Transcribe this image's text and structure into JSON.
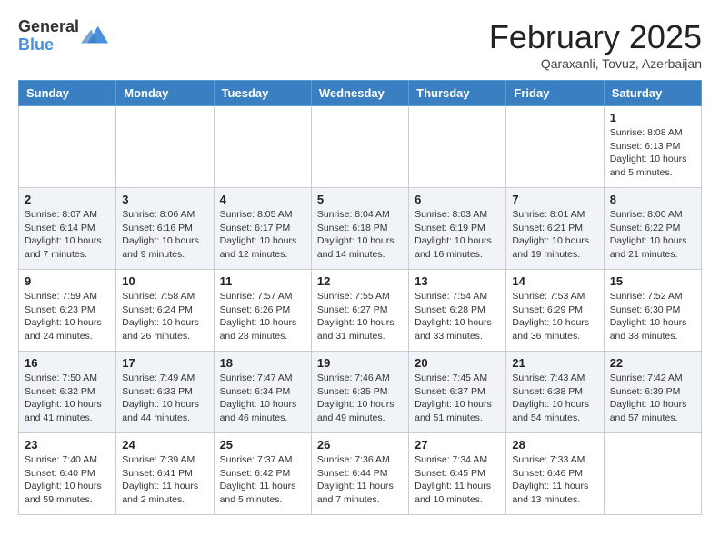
{
  "header": {
    "logo_general": "General",
    "logo_blue": "Blue",
    "month_title": "February 2025",
    "subtitle": "Qaraxanli, Tovuz, Azerbaijan"
  },
  "days_of_week": [
    "Sunday",
    "Monday",
    "Tuesday",
    "Wednesday",
    "Thursday",
    "Friday",
    "Saturday"
  ],
  "weeks": [
    [
      {
        "day": "",
        "info": ""
      },
      {
        "day": "",
        "info": ""
      },
      {
        "day": "",
        "info": ""
      },
      {
        "day": "",
        "info": ""
      },
      {
        "day": "",
        "info": ""
      },
      {
        "day": "",
        "info": ""
      },
      {
        "day": "1",
        "info": "Sunrise: 8:08 AM\nSunset: 6:13 PM\nDaylight: 10 hours\nand 5 minutes."
      }
    ],
    [
      {
        "day": "2",
        "info": "Sunrise: 8:07 AM\nSunset: 6:14 PM\nDaylight: 10 hours\nand 7 minutes."
      },
      {
        "day": "3",
        "info": "Sunrise: 8:06 AM\nSunset: 6:16 PM\nDaylight: 10 hours\nand 9 minutes."
      },
      {
        "day": "4",
        "info": "Sunrise: 8:05 AM\nSunset: 6:17 PM\nDaylight: 10 hours\nand 12 minutes."
      },
      {
        "day": "5",
        "info": "Sunrise: 8:04 AM\nSunset: 6:18 PM\nDaylight: 10 hours\nand 14 minutes."
      },
      {
        "day": "6",
        "info": "Sunrise: 8:03 AM\nSunset: 6:19 PM\nDaylight: 10 hours\nand 16 minutes."
      },
      {
        "day": "7",
        "info": "Sunrise: 8:01 AM\nSunset: 6:21 PM\nDaylight: 10 hours\nand 19 minutes."
      },
      {
        "day": "8",
        "info": "Sunrise: 8:00 AM\nSunset: 6:22 PM\nDaylight: 10 hours\nand 21 minutes."
      }
    ],
    [
      {
        "day": "9",
        "info": "Sunrise: 7:59 AM\nSunset: 6:23 PM\nDaylight: 10 hours\nand 24 minutes."
      },
      {
        "day": "10",
        "info": "Sunrise: 7:58 AM\nSunset: 6:24 PM\nDaylight: 10 hours\nand 26 minutes."
      },
      {
        "day": "11",
        "info": "Sunrise: 7:57 AM\nSunset: 6:26 PM\nDaylight: 10 hours\nand 28 minutes."
      },
      {
        "day": "12",
        "info": "Sunrise: 7:55 AM\nSunset: 6:27 PM\nDaylight: 10 hours\nand 31 minutes."
      },
      {
        "day": "13",
        "info": "Sunrise: 7:54 AM\nSunset: 6:28 PM\nDaylight: 10 hours\nand 33 minutes."
      },
      {
        "day": "14",
        "info": "Sunrise: 7:53 AM\nSunset: 6:29 PM\nDaylight: 10 hours\nand 36 minutes."
      },
      {
        "day": "15",
        "info": "Sunrise: 7:52 AM\nSunset: 6:30 PM\nDaylight: 10 hours\nand 38 minutes."
      }
    ],
    [
      {
        "day": "16",
        "info": "Sunrise: 7:50 AM\nSunset: 6:32 PM\nDaylight: 10 hours\nand 41 minutes."
      },
      {
        "day": "17",
        "info": "Sunrise: 7:49 AM\nSunset: 6:33 PM\nDaylight: 10 hours\nand 44 minutes."
      },
      {
        "day": "18",
        "info": "Sunrise: 7:47 AM\nSunset: 6:34 PM\nDaylight: 10 hours\nand 46 minutes."
      },
      {
        "day": "19",
        "info": "Sunrise: 7:46 AM\nSunset: 6:35 PM\nDaylight: 10 hours\nand 49 minutes."
      },
      {
        "day": "20",
        "info": "Sunrise: 7:45 AM\nSunset: 6:37 PM\nDaylight: 10 hours\nand 51 minutes."
      },
      {
        "day": "21",
        "info": "Sunrise: 7:43 AM\nSunset: 6:38 PM\nDaylight: 10 hours\nand 54 minutes."
      },
      {
        "day": "22",
        "info": "Sunrise: 7:42 AM\nSunset: 6:39 PM\nDaylight: 10 hours\nand 57 minutes."
      }
    ],
    [
      {
        "day": "23",
        "info": "Sunrise: 7:40 AM\nSunset: 6:40 PM\nDaylight: 10 hours\nand 59 minutes."
      },
      {
        "day": "24",
        "info": "Sunrise: 7:39 AM\nSunset: 6:41 PM\nDaylight: 11 hours\nand 2 minutes."
      },
      {
        "day": "25",
        "info": "Sunrise: 7:37 AM\nSunset: 6:42 PM\nDaylight: 11 hours\nand 5 minutes."
      },
      {
        "day": "26",
        "info": "Sunrise: 7:36 AM\nSunset: 6:44 PM\nDaylight: 11 hours\nand 7 minutes."
      },
      {
        "day": "27",
        "info": "Sunrise: 7:34 AM\nSunset: 6:45 PM\nDaylight: 11 hours\nand 10 minutes."
      },
      {
        "day": "28",
        "info": "Sunrise: 7:33 AM\nSunset: 6:46 PM\nDaylight: 11 hours\nand 13 minutes."
      },
      {
        "day": "",
        "info": ""
      }
    ]
  ]
}
